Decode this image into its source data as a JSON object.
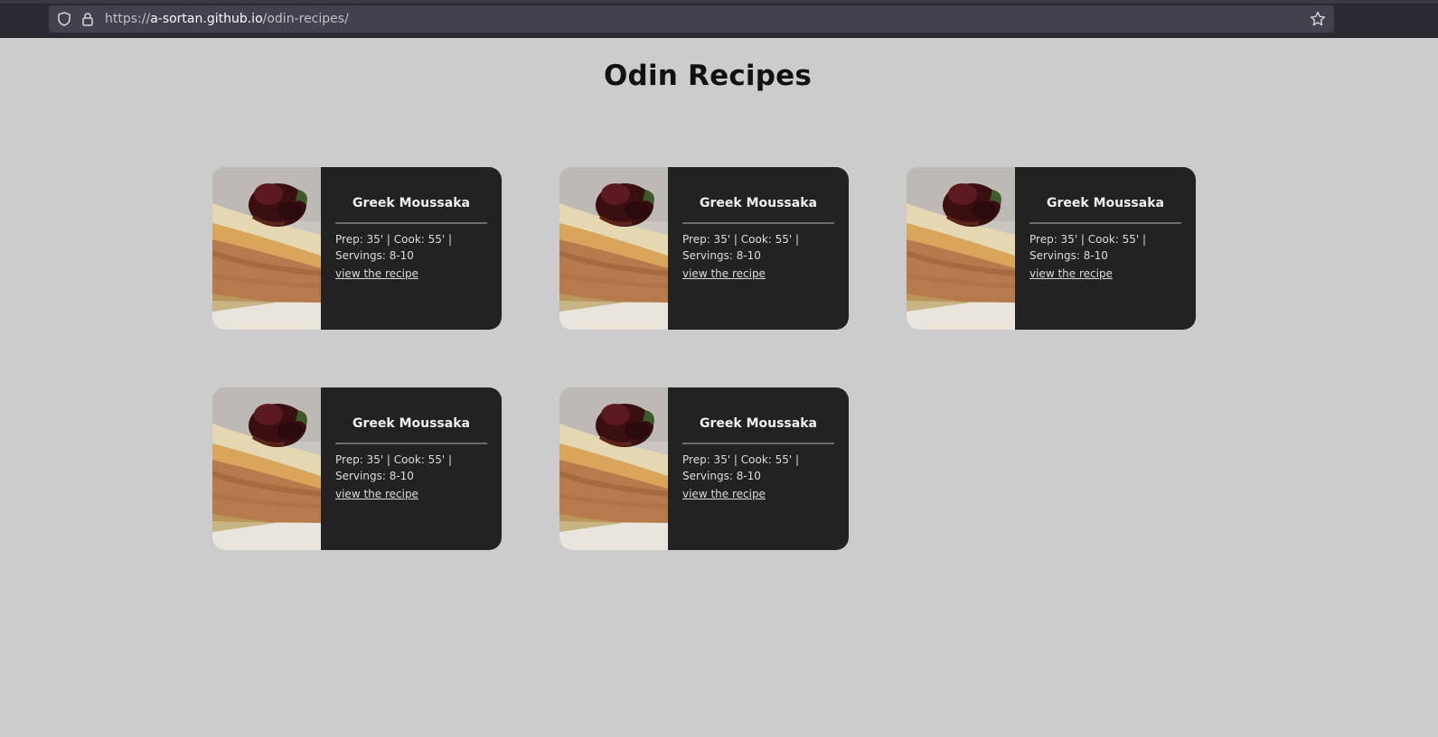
{
  "browser": {
    "url_prefix": "https://",
    "url_host": "a-sortan.github.io",
    "url_path": "/odin-recipes/"
  },
  "page": {
    "title": "Odin Recipes"
  },
  "recipes": [
    {
      "title": "Greek Moussaka",
      "meta": "Prep: 35' | Cook: 55' | Servings: 8-10",
      "link": "view the recipe"
    },
    {
      "title": "Greek Moussaka",
      "meta": "Prep: 35' | Cook: 55' | Servings: 8-10",
      "link": "view the recipe"
    },
    {
      "title": "Greek Moussaka",
      "meta": "Prep: 35' | Cook: 55' | Servings: 8-10",
      "link": "view the recipe"
    },
    {
      "title": "Greek Moussaka",
      "meta": "Prep: 35' | Cook: 55' | Servings: 8-10",
      "link": "view the recipe"
    },
    {
      "title": "Greek Moussaka",
      "meta": "Prep: 35' | Cook: 55' | Servings: 8-10",
      "link": "view the recipe"
    }
  ]
}
